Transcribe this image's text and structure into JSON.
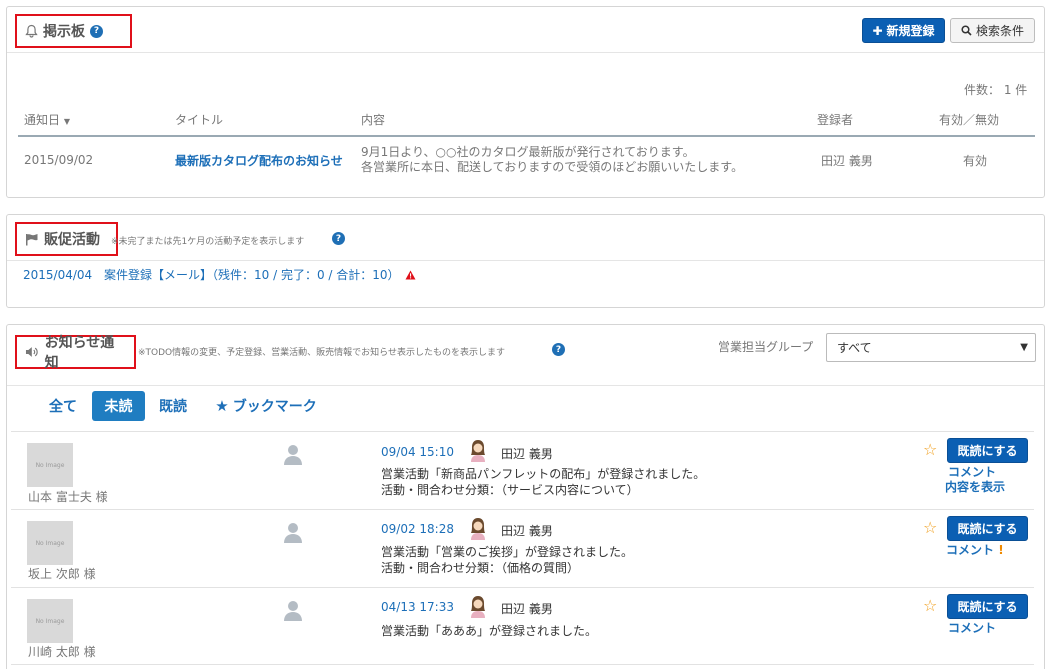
{
  "bulletin": {
    "title": "掲示板",
    "new_button": "新規登録",
    "search_button": "検索条件",
    "count_label": "件数：",
    "count_value": "1 件",
    "columns": [
      "通知日",
      "タイトル",
      "内容",
      "登録者",
      "有効／無効"
    ],
    "rows": [
      {
        "date": "2015/09/02",
        "title": "最新版カタログ配布のお知らせ",
        "content_line1": "9月1日より、○○社のカタログ最新版が発行されております。",
        "content_line2": "各営業所に本日、配送しておりますので受領のほどお願いいたします。",
        "author": "田辺 義男",
        "status": "有効"
      }
    ]
  },
  "promo": {
    "title": "販促活動",
    "note": "※未完了または先1ケ月の活動予定を表示します",
    "item_date": "2015/04/04",
    "item_text": "案件登録【メール】（残件：10 / 完了：0 / 合計：10）"
  },
  "notices": {
    "title": "お知らせ通知",
    "note": "※TODO情報の変更、予定登録、営業活動、販売情報でお知らせ表示したものを表示します",
    "group_label": "営業担当グループ",
    "group_selected": "すべて",
    "tabs": [
      "全て",
      "未読",
      "既読",
      "ブックマーク"
    ],
    "no_image": "No Image",
    "read_button": "既読にする",
    "items": [
      {
        "customer": "山本 富士夫 様",
        "time": "09/04 15:10",
        "user": "田辺 義男",
        "line1": "営業活動「新商品パンフレットの配布」が登録されました。",
        "line2": "活動・問合わせ分類：（サービス内容について）",
        "comment": "コメント",
        "extra": "内容を表示"
      },
      {
        "customer": "坂上 次郎 様",
        "time": "09/02 18:28",
        "user": "田辺 義男",
        "line1": "営業活動「営業のご挨拶」が登録されました。",
        "line2": "活動・問合わせ分類：（価格の質問）",
        "comment": "コメント",
        "mark": "!"
      },
      {
        "customer": "川崎 太郎 様",
        "time": "04/13 17:33",
        "user": "田辺 義男",
        "line1": "営業活動「あああ」が登録されました。",
        "comment": "コメント"
      }
    ]
  }
}
